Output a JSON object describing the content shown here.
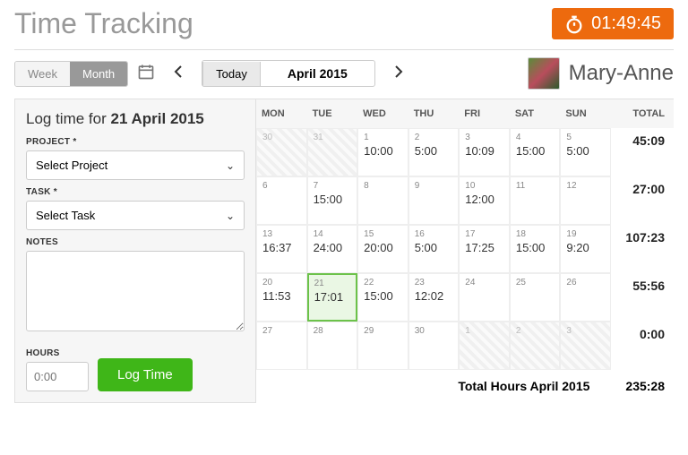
{
  "header": {
    "title": "Time Tracking",
    "timer": "01:49:45"
  },
  "toolbar": {
    "view_week": "Week",
    "view_month": "Month",
    "today": "Today",
    "period": "April 2015"
  },
  "user": {
    "name": "Mary-Anne"
  },
  "form": {
    "title_prefix": "Log time for ",
    "title_date": "21 April 2015",
    "project_label": "PROJECT *",
    "project_placeholder": "Select Project",
    "task_label": "TASK *",
    "task_placeholder": "Select Task",
    "notes_label": "NOTES",
    "hours_label": "HOURS",
    "hours_placeholder": "0:00",
    "submit": "Log Time"
  },
  "calendar": {
    "day_headers": [
      "MON",
      "TUE",
      "WED",
      "THU",
      "FRI",
      "SAT",
      "SUN",
      "TOTAL"
    ],
    "rows": [
      {
        "cells": [
          {
            "num": "30",
            "val": "",
            "faded": true
          },
          {
            "num": "31",
            "val": "",
            "faded": true
          },
          {
            "num": "1",
            "val": "10:00"
          },
          {
            "num": "2",
            "val": "5:00"
          },
          {
            "num": "3",
            "val": "10:09"
          },
          {
            "num": "4",
            "val": "15:00"
          },
          {
            "num": "5",
            "val": "5:00"
          }
        ],
        "total": "45:09"
      },
      {
        "cells": [
          {
            "num": "6",
            "val": ""
          },
          {
            "num": "7",
            "val": "15:00"
          },
          {
            "num": "8",
            "val": ""
          },
          {
            "num": "9",
            "val": ""
          },
          {
            "num": "10",
            "val": "12:00"
          },
          {
            "num": "11",
            "val": ""
          },
          {
            "num": "12",
            "val": ""
          }
        ],
        "total": "27:00"
      },
      {
        "cells": [
          {
            "num": "13",
            "val": "16:37"
          },
          {
            "num": "14",
            "val": "24:00"
          },
          {
            "num": "15",
            "val": "20:00"
          },
          {
            "num": "16",
            "val": "5:00"
          },
          {
            "num": "17",
            "val": "17:25"
          },
          {
            "num": "18",
            "val": "15:00"
          },
          {
            "num": "19",
            "val": "9:20"
          }
        ],
        "total": "107:23"
      },
      {
        "cells": [
          {
            "num": "20",
            "val": "11:53"
          },
          {
            "num": "21",
            "val": "17:01",
            "selected": true
          },
          {
            "num": "22",
            "val": "15:00"
          },
          {
            "num": "23",
            "val": "12:02"
          },
          {
            "num": "24",
            "val": ""
          },
          {
            "num": "25",
            "val": ""
          },
          {
            "num": "26",
            "val": ""
          }
        ],
        "total": "55:56"
      },
      {
        "cells": [
          {
            "num": "27",
            "val": ""
          },
          {
            "num": "28",
            "val": ""
          },
          {
            "num": "29",
            "val": ""
          },
          {
            "num": "30",
            "val": ""
          },
          {
            "num": "1",
            "val": "",
            "faded": true
          },
          {
            "num": "2",
            "val": "",
            "faded": true
          },
          {
            "num": "3",
            "val": "",
            "faded": true
          }
        ],
        "total": "0:00"
      }
    ],
    "grand_label": "Total Hours April 2015",
    "grand_value": "235:28"
  }
}
